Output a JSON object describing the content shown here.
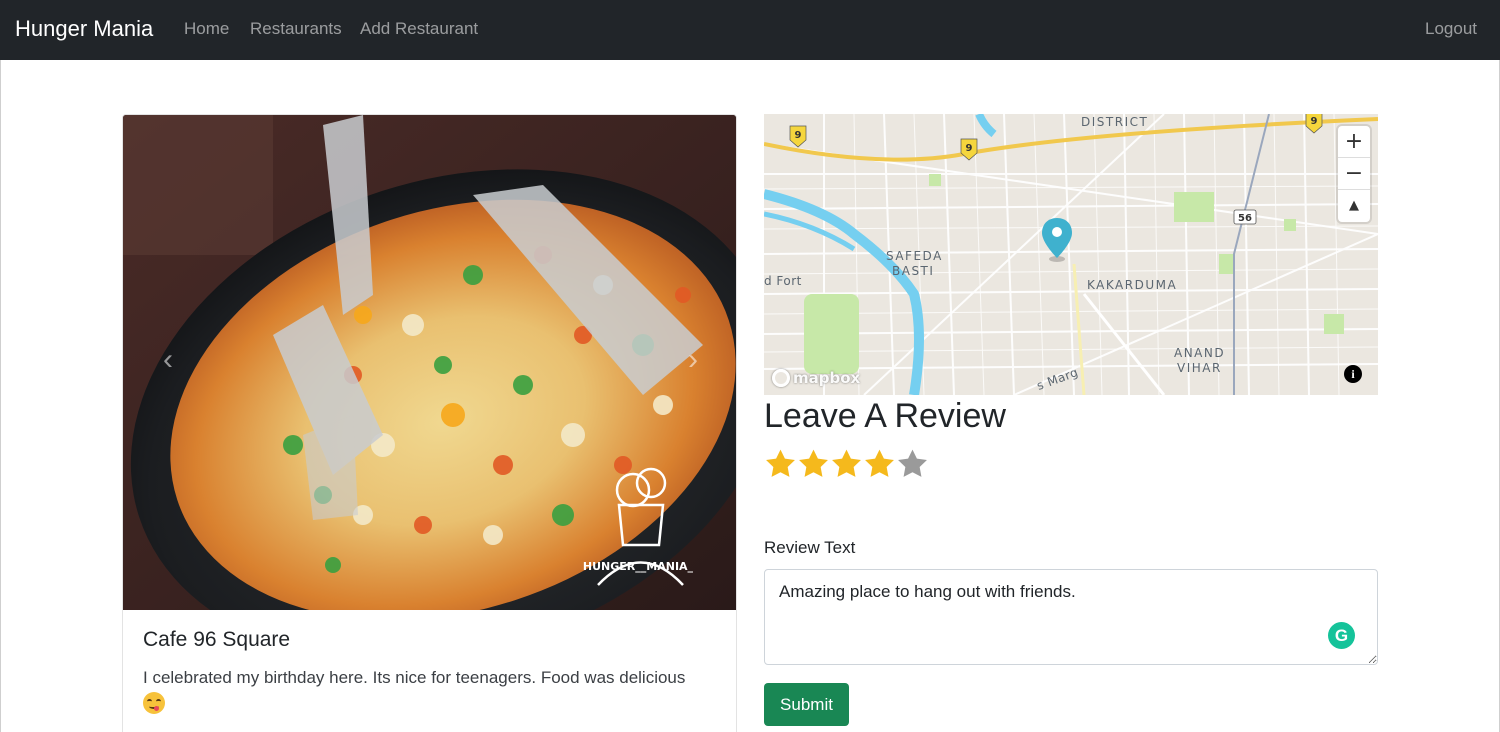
{
  "navbar": {
    "brand": "Hunger Mania",
    "links": [
      {
        "label": "Home"
      },
      {
        "label": "Restaurants"
      },
      {
        "label": "Add Restaurant"
      }
    ],
    "logout": "Logout",
    "background": "#212529"
  },
  "restaurant": {
    "image_watermark": "HUNGER__MANIA_",
    "carousel_prev": "‹",
    "carousel_next": "›",
    "review_title": "Cafe 96 Square",
    "review_body": "I celebrated my birthday here. Its nice for teenagers. Food was delicious",
    "emoji_icon": "face-savoring-food-icon"
  },
  "map": {
    "labels": {
      "district": "DISTRICT",
      "safeda_1": "SAFEDA",
      "safeda_2": "BASTI",
      "fort": "d Fort",
      "kakarduma": "KAKARDUMA",
      "anand_1": "ANAND",
      "anand_2": "VIHAR",
      "marg": "s Marg",
      "route_9": "9",
      "route_56": "56"
    },
    "controls": {
      "zoom_in": "+",
      "zoom_out": "−",
      "compass": "▲"
    },
    "attribution": "mapbox",
    "info": "i",
    "marker_color": "#3fb1ce"
  },
  "review_form": {
    "heading": "Leave A Review",
    "rating": 4,
    "rating_max": 5,
    "star_color_filled": "#f5b91c",
    "star_color_empty": "#9a9a9a",
    "text_label": "Review Text",
    "text_value": "Amazing place to hang out with friends.",
    "grammarly_icon": "G",
    "submit_label": "Submit",
    "submit_color": "#198754"
  }
}
